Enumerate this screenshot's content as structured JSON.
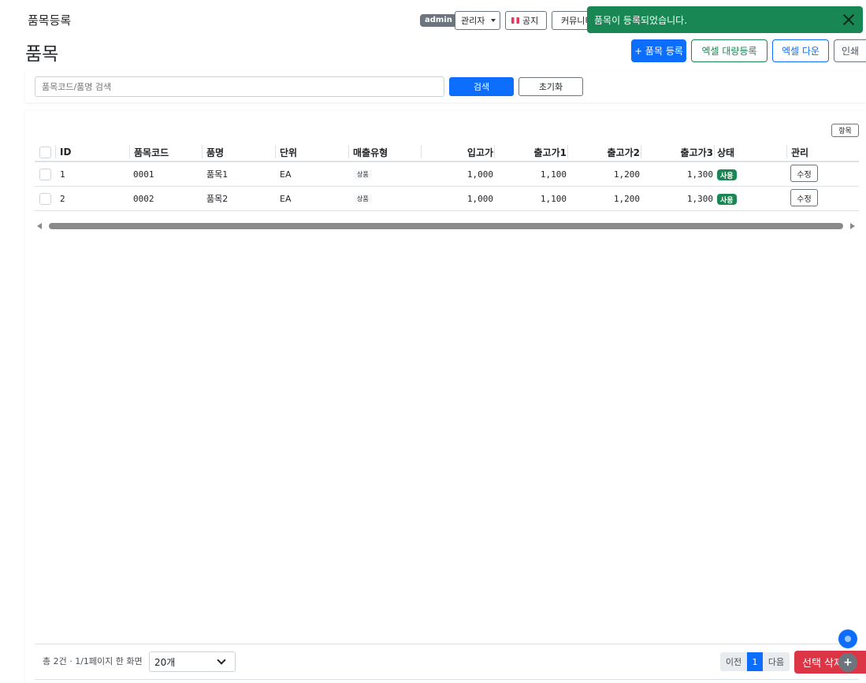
{
  "header": {
    "breadcrumb": "품목등록",
    "page_title": "품목",
    "badge": "admin",
    "user_menu": "관리자",
    "notice": "공지",
    "community": "커뮤니티"
  },
  "toast": {
    "message": "품목이 등록되었습니다.",
    "color": "#198754"
  },
  "actions": {
    "add": "+ 품목 등록",
    "bulk_excel": "엑셀 대량등록",
    "excel_download": "엑셀 다운",
    "print": "인쇄"
  },
  "search": {
    "placeholder": "품목코드/품명 검색",
    "search_label": "검색",
    "reset_label": "초기화"
  },
  "table": {
    "columns_button": "항목",
    "headers": [
      "ID",
      "품목코드",
      "품명",
      "단위",
      "매출유형",
      "입고가",
      "출고가1",
      "출고가2",
      "출고가3",
      "상태",
      "관리"
    ],
    "rows": [
      {
        "id": "1",
        "code": "0001",
        "name": "품목1",
        "unit": "EA",
        "type": "상품",
        "in_price": "1,000",
        "out1": "1,100",
        "out2": "1,200",
        "out3": "1,300",
        "status": "사용",
        "edit": "수정"
      },
      {
        "id": "2",
        "code": "0002",
        "name": "품목2",
        "unit": "EA",
        "type": "상품",
        "in_price": "1,000",
        "out1": "1,100",
        "out2": "1,200",
        "out3": "1,300",
        "status": "사용",
        "edit": "수정"
      }
    ]
  },
  "footer": {
    "info": "총 2건 · 1/1페이지  한 화면",
    "page_size": "20개",
    "prev": "이전",
    "current_page": "1",
    "next": "다음",
    "delete_selected": "선택 삭제"
  },
  "colors": {
    "primary": "#0d6efd",
    "success": "#198754",
    "danger": "#dc3545",
    "secondary": "#6c757d"
  }
}
